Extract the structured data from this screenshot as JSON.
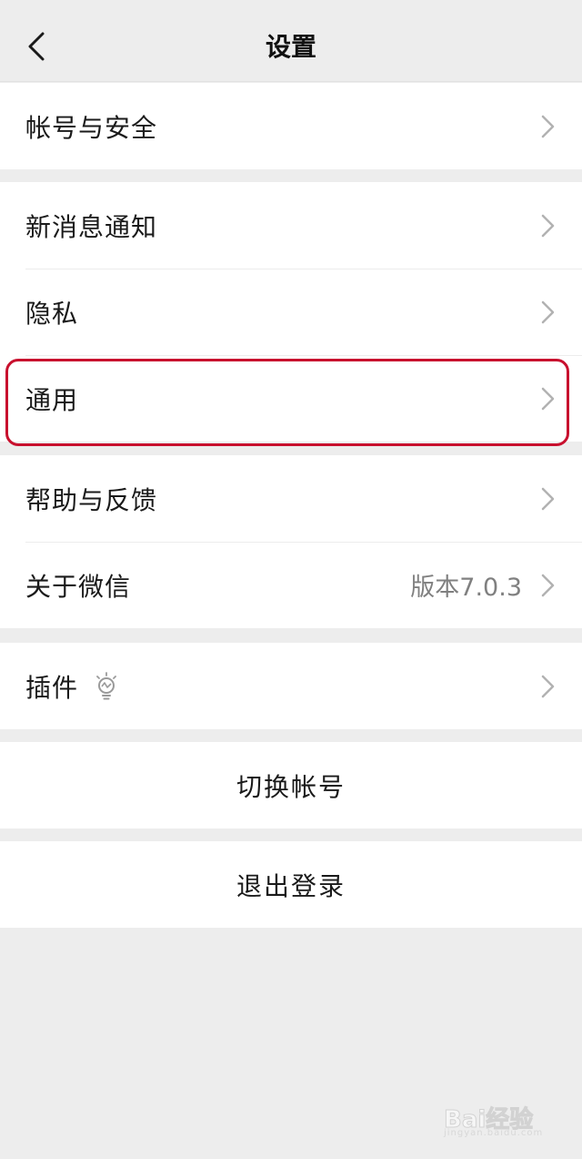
{
  "nav": {
    "title": "设置"
  },
  "groups": {
    "account": {
      "label": "帐号与安全"
    },
    "notifications": {
      "label": "新消息通知"
    },
    "privacy": {
      "label": "隐私"
    },
    "general": {
      "label": "通用"
    },
    "help": {
      "label": "帮助与反馈"
    },
    "about": {
      "label": "关于微信",
      "value": "版本7.0.3"
    },
    "plugins": {
      "label": "插件"
    }
  },
  "actions": {
    "switch_account": "切换帐号",
    "logout": "退出登录"
  },
  "icons": {
    "back": "chevron-left-icon",
    "row": "chevron-right-icon",
    "plugin": "lightbulb-icon"
  },
  "colors": {
    "background": "#ededed",
    "card": "#ffffff",
    "highlight": "#c8102e",
    "chevron": "#b2b2b2",
    "secondary_text": "#808080"
  },
  "watermark": {
    "logo": "Bai经验",
    "sub": "jingyan.baidu.com"
  }
}
